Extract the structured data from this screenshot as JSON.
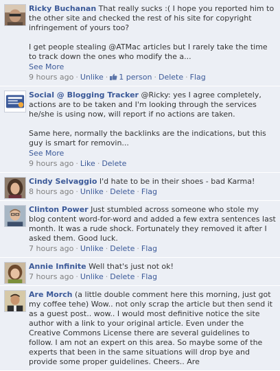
{
  "comments": [
    {
      "author": "Ricky Buchanan",
      "text": "That really sucks :( I hope you reported him to the other site and checked the rest of his site for copyright infringement of yours too?",
      "text2": "I get people stealing @ATMac articles but I rarely take the time to track down the ones who modify the a...",
      "see_more": "See More",
      "time": "9 hours ago",
      "action": "Unlike",
      "likes": "1 person",
      "delete": "Delete",
      "flag": "Flag"
    },
    {
      "author": "Social @ Blogging Tracker",
      "text": "@Ricky: yes I agree completely, actions are to be taken and I'm looking through the services he/she is using now, will report if no actions are taken.",
      "text2": "Same here, normally the backlinks are the indications, but this guy is smart for removin...",
      "see_more": "See More",
      "time": "9 hours ago",
      "action": "Like",
      "delete": "Delete"
    },
    {
      "author": "Cindy Selvaggio",
      "text": "I'd hate to be in their shoes - bad Karma!",
      "time": "8 hours ago",
      "action": "Unlike",
      "delete": "Delete",
      "flag": "Flag"
    },
    {
      "author": "Clinton Power",
      "text": "Just stumbled across someone who stole my blog content word-for-word and added a few extra sentences last month. It was a rude shock. Fortunately they removed it after I asked them. Good luck.",
      "time": "7 hours ago",
      "action": "Unlike",
      "delete": "Delete",
      "flag": "Flag"
    },
    {
      "author": "Annie Infinite",
      "text": "Well that's just not ok!",
      "time": "7 hours ago",
      "action": "Unlike",
      "delete": "Delete",
      "flag": "Flag"
    },
    {
      "author": "Are Morch",
      "text": "(a little double comment here this morning, just got my coffee tehe) Wow.. not only scrap the article but then send it as a guest post.. wow.. I would most definitive notice the site author with a link to your original article. Even under the Creative Commons License there are several guidelines to follow. I am not an expert on this area. So maybe some of the experts that been in the same situations will drop bye and provide some proper guidelines. Cheers.. Are"
    }
  ],
  "colors": {
    "background": "#eceff5",
    "link": "#3b5998",
    "meta": "#7f7f7f"
  }
}
